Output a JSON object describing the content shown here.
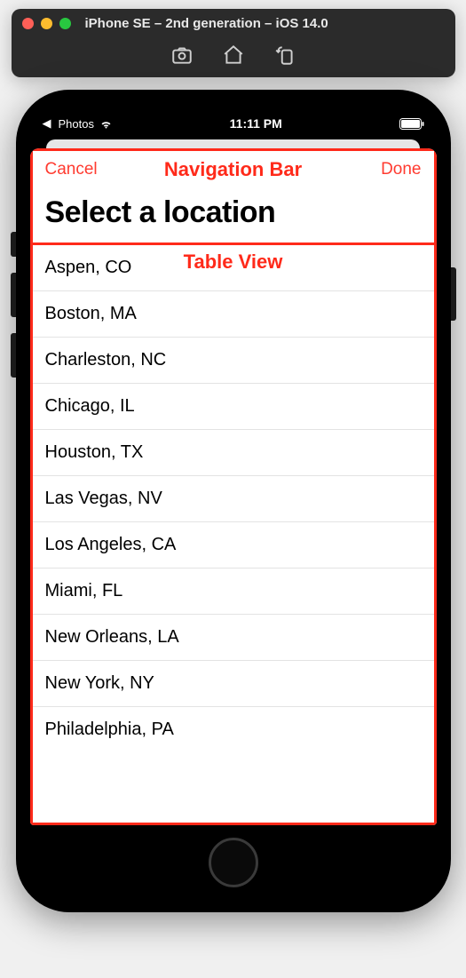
{
  "simulator": {
    "title": "iPhone SE – 2nd generation – iOS 14.0"
  },
  "status_bar": {
    "back_app": "Photos",
    "time": "11:11 PM"
  },
  "nav_bar": {
    "cancel_label": "Cancel",
    "done_label": "Done",
    "annotation_label": "Navigation Bar",
    "large_title": "Select a location"
  },
  "table": {
    "annotation_label": "Table View",
    "rows": [
      "Aspen, CO",
      "Boston, MA",
      "Charleston, NC",
      "Chicago, IL",
      "Houston, TX",
      "Las Vegas, NV",
      "Los Angeles, CA",
      "Miami, FL",
      "New Orleans, LA",
      "New York, NY",
      "Philadelphia, PA"
    ]
  }
}
